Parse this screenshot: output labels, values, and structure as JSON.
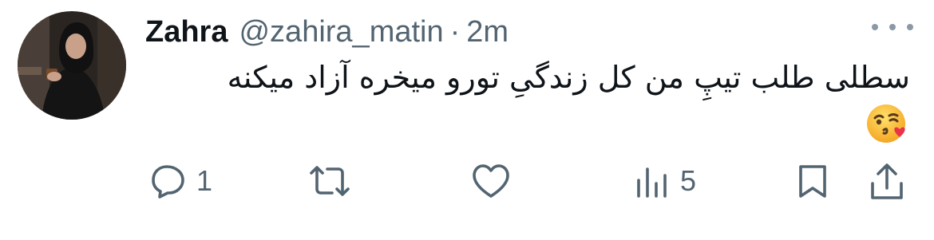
{
  "tweet": {
    "display_name": "Zahra",
    "handle": "@zahira_matin",
    "separator": "·",
    "time": "2m",
    "text": "سطلی طلب تیپِ من کل زندگیِ تورو میخره آزاد میکنه",
    "emoji": "face-blowing-a-kiss"
  },
  "actions": {
    "reply_count": "1",
    "views_count": "5"
  },
  "colors": {
    "text": "#0f1419",
    "secondary": "#536471",
    "icon": "#536471",
    "background": "#ffffff"
  },
  "icons": [
    "more-icon",
    "reply-icon",
    "retweet-icon",
    "like-icon",
    "views-icon",
    "bookmark-icon",
    "share-icon"
  ]
}
